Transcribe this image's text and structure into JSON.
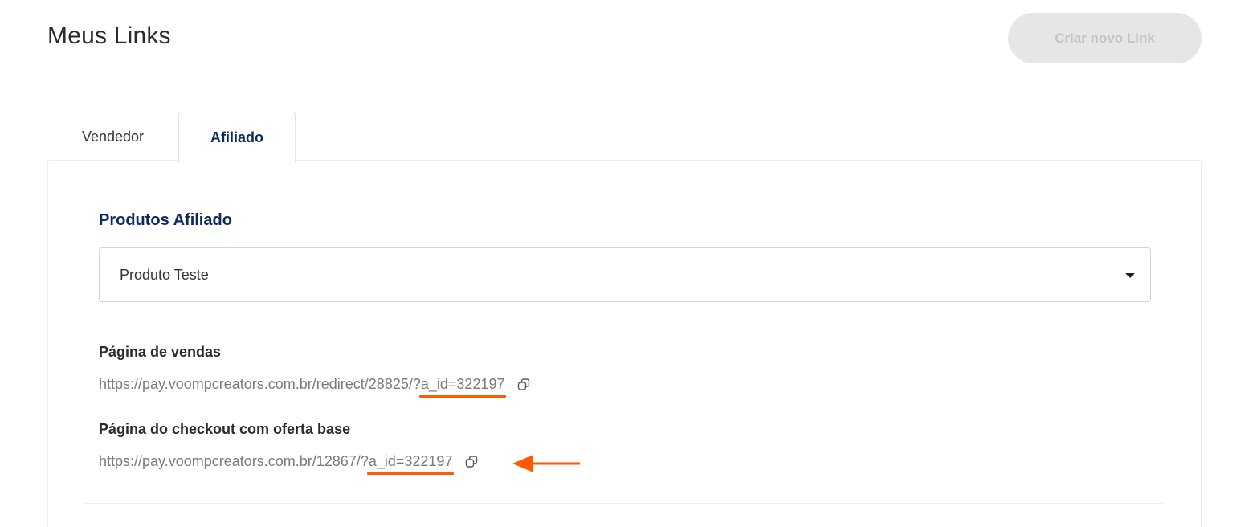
{
  "header": {
    "title": "Meus Links",
    "create_button_label": "Criar novo Link"
  },
  "tabs": [
    {
      "label": "Vendedor",
      "active": false
    },
    {
      "label": "Afiliado",
      "active": true
    }
  ],
  "affiliate": {
    "section_title": "Produtos Afiliado",
    "product_select_value": "Produto Teste",
    "sales_page": {
      "label": "Página de vendas",
      "url_prefix": "https://pay.voompcreators.com.br/redirect/28825/?",
      "url_param": "a_id=322197"
    },
    "checkout_page": {
      "label": "Página do checkout com oferta base",
      "url_prefix": "https://pay.voompcreators.com.br/12867/?",
      "url_param": "a_id=322197"
    }
  },
  "colors": {
    "accent_navy": "#0d2a5e",
    "annotation_orange": "#ff5a00",
    "disabled_button_bg": "#e6e6e6"
  },
  "icons": {
    "copy": "copy-icon",
    "dropdown": "chevron-down-icon",
    "annotation": "arrow-left-icon"
  }
}
